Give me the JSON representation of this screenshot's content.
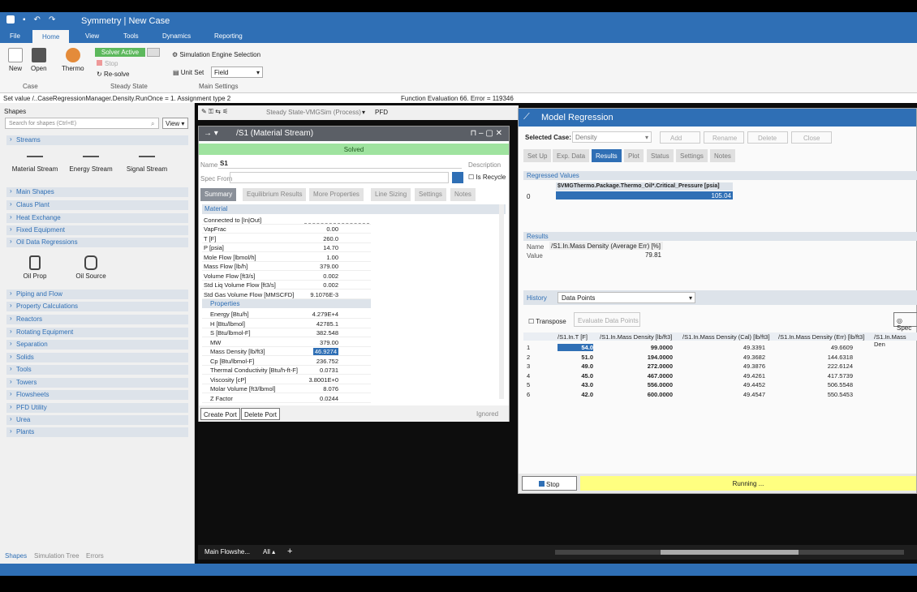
{
  "app": {
    "title": "Symmetry | New Case"
  },
  "ribbon_tabs": [
    "File",
    "Home",
    "View",
    "Tools",
    "Dynamics",
    "Reporting"
  ],
  "ribbon": {
    "new": "New",
    "open": "Open",
    "thermo": "Thermo",
    "case_group": "Case",
    "solver_active": "Solver Active",
    "stop": "Stop",
    "resolve": "Re-solve",
    "steady_state_group": "Steady State",
    "sim_engine": "Simulation Engine Selection",
    "unit_set_label": "Unit Set",
    "unit_set_value": "Field",
    "main_settings_group": "Main Settings"
  },
  "status": {
    "left": "Set value /..CaseRegressionManager.Density.RunOnce = 1. Assignment type 2",
    "right": "Function Evaluation 66. Error = 119346"
  },
  "shapes": {
    "title": "Shapes",
    "search_placeholder": "Search for shapes (Ctrl+E)",
    "view": "View",
    "sections": [
      "Streams",
      "Main Shapes",
      "Claus Plant",
      "Heat Exchange",
      "Fixed Equipment",
      "Oil Data Regressions",
      "Piping and Flow",
      "Property Calculations",
      "Reactors",
      "Rotating Equipment",
      "Separation",
      "Solids",
      "Tools",
      "Towers",
      "Flowsheets",
      "PFD Utility",
      "Urea",
      "Plants"
    ],
    "stream_items": [
      "Material Stream",
      "Energy Stream",
      "Signal Stream"
    ],
    "oil_items": [
      "Oil Prop",
      "Oil Source"
    ],
    "bottom_tabs": [
      "Shapes",
      "Simulation Tree",
      "Errors"
    ]
  },
  "flowsheet": {
    "mode": "Steady State-VMGSim (Process)",
    "pfd": "PFD",
    "tab": "Main Flowshe...",
    "all": "All"
  },
  "material": {
    "title": "/S1 (Material Stream)",
    "solved": "Solved",
    "name_label": "Name",
    "name_value": "S1",
    "description": "Description",
    "spec_from": "Spec From",
    "recycle": "Is Recycle",
    "tabs": [
      "Summary",
      "Equilibrium Results",
      "More Properties",
      "Line Sizing",
      "Settings",
      "Notes"
    ],
    "section": "Material",
    "connected": "Connected to [In|Out]",
    "rows": [
      [
        "VapFrac",
        "0.00"
      ],
      [
        "T [F]",
        "260.0"
      ],
      [
        "P [psia]",
        "14.70"
      ],
      [
        "Mole Flow [lbmol/h]",
        "1.00"
      ],
      [
        "Mass Flow [lb/h]",
        "379.00"
      ],
      [
        "Volume Flow [ft3/s]",
        "0.002"
      ],
      [
        "Std Liq Volume Flow [ft3/s]",
        "0.002"
      ],
      [
        "Std Gas Volume Flow [MMSCFD]",
        "9.1076E-3"
      ]
    ],
    "properties_label": "Properties",
    "prop_rows": [
      [
        "Energy [Btu/h]",
        "4.279E+4"
      ],
      [
        "H [Btu/lbmol]",
        "42785.1"
      ],
      [
        "S [Btu/lbmol-F]",
        "382.548"
      ],
      [
        "MW",
        "379.00"
      ],
      [
        "Mass Density [lb/ft3]",
        "46.9274"
      ],
      [
        "Cp [Btu/lbmol-F]",
        "236.752"
      ],
      [
        "Thermal Conductivity [Btu/h-ft-F]",
        "0.0731"
      ],
      [
        "Viscosity [cP]",
        "3.8001E+0"
      ],
      [
        "Molar Volume [ft3/lbmol]",
        "8.076"
      ],
      [
        "Z Factor",
        "0.0244"
      ]
    ],
    "create_port": "Create Port",
    "delete_port": "Delete Port",
    "ignored": "Ignored"
  },
  "regression": {
    "title": "Model Regression",
    "selected_case_label": "Selected Case:",
    "selected_case": "Density",
    "buttons": [
      "Add",
      "Rename",
      "Delete",
      "Close"
    ],
    "tabs": [
      "Set Up",
      "Exp. Data",
      "Results",
      "Plot",
      "Status",
      "Settings",
      "Notes"
    ],
    "regressed_values": "Regressed Values",
    "rv_header": "$VMGThermo.Package.Thermo_Oil*.Critical_Pressure [psia]",
    "rv_index": "0",
    "rv_value": "105.04",
    "results": "Results",
    "name_label": "Name",
    "name_value": "/S1.In.Mass Density (Average Err) [%]",
    "value_label": "Value",
    "value": "79.81",
    "history": "History",
    "history_select": "Data Points",
    "transpose": "Transpose",
    "evaluate": "Evaluate Data Points",
    "spec": "Spec",
    "cols": [
      "/S1.In.T [F]",
      "/S1.In.Mass Density [lb/ft3]",
      "/S1.In.Mass Density (Cal) [lb/ft3]",
      "/S1.In.Mass Density (Err) [lb/ft3]",
      "/S1.In.Mass Den"
    ],
    "rows": [
      [
        "1",
        "54.0",
        "99.0000",
        "49.3391",
        "49.6609"
      ],
      [
        "2",
        "51.0",
        "194.0000",
        "49.3682",
        "144.6318"
      ],
      [
        "3",
        "49.0",
        "272.0000",
        "49.3876",
        "222.6124"
      ],
      [
        "4",
        "45.0",
        "467.0000",
        "49.4261",
        "417.5739"
      ],
      [
        "5",
        "43.0",
        "556.0000",
        "49.4452",
        "506.5548"
      ],
      [
        "6",
        "42.0",
        "600.0000",
        "49.4547",
        "550.5453"
      ]
    ],
    "stop": "Stop",
    "running": "Running ..."
  }
}
